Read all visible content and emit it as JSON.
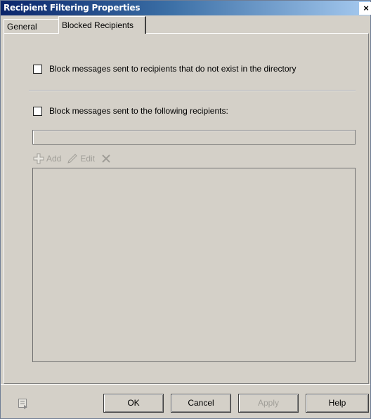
{
  "window": {
    "title": "Recipient Filtering Properties",
    "close_label": "×"
  },
  "tabs": [
    {
      "label": "General",
      "selected": false
    },
    {
      "label": "Blocked Recipients",
      "selected": true
    }
  ],
  "options": {
    "block_nonexistent": {
      "label": "Block messages sent to recipients that do not exist in the directory",
      "checked": false
    },
    "block_following": {
      "label": "Block messages sent to the following recipients:",
      "checked": false
    }
  },
  "recipient_input": {
    "value": ""
  },
  "toolbar": {
    "add_label": "Add",
    "add_icon": "add-icon",
    "edit_label": "Edit",
    "edit_icon": "pencil-icon",
    "remove_icon": "delete-icon",
    "disabled_color": "#a09e98"
  },
  "recipients_list": [],
  "buttons": {
    "ok": "OK",
    "cancel": "Cancel",
    "apply": "Apply",
    "help": "Help"
  },
  "colors": {
    "dialog_bg": "#d4d0c8",
    "title_start": "#0a246a",
    "title_end": "#a6caf0"
  }
}
